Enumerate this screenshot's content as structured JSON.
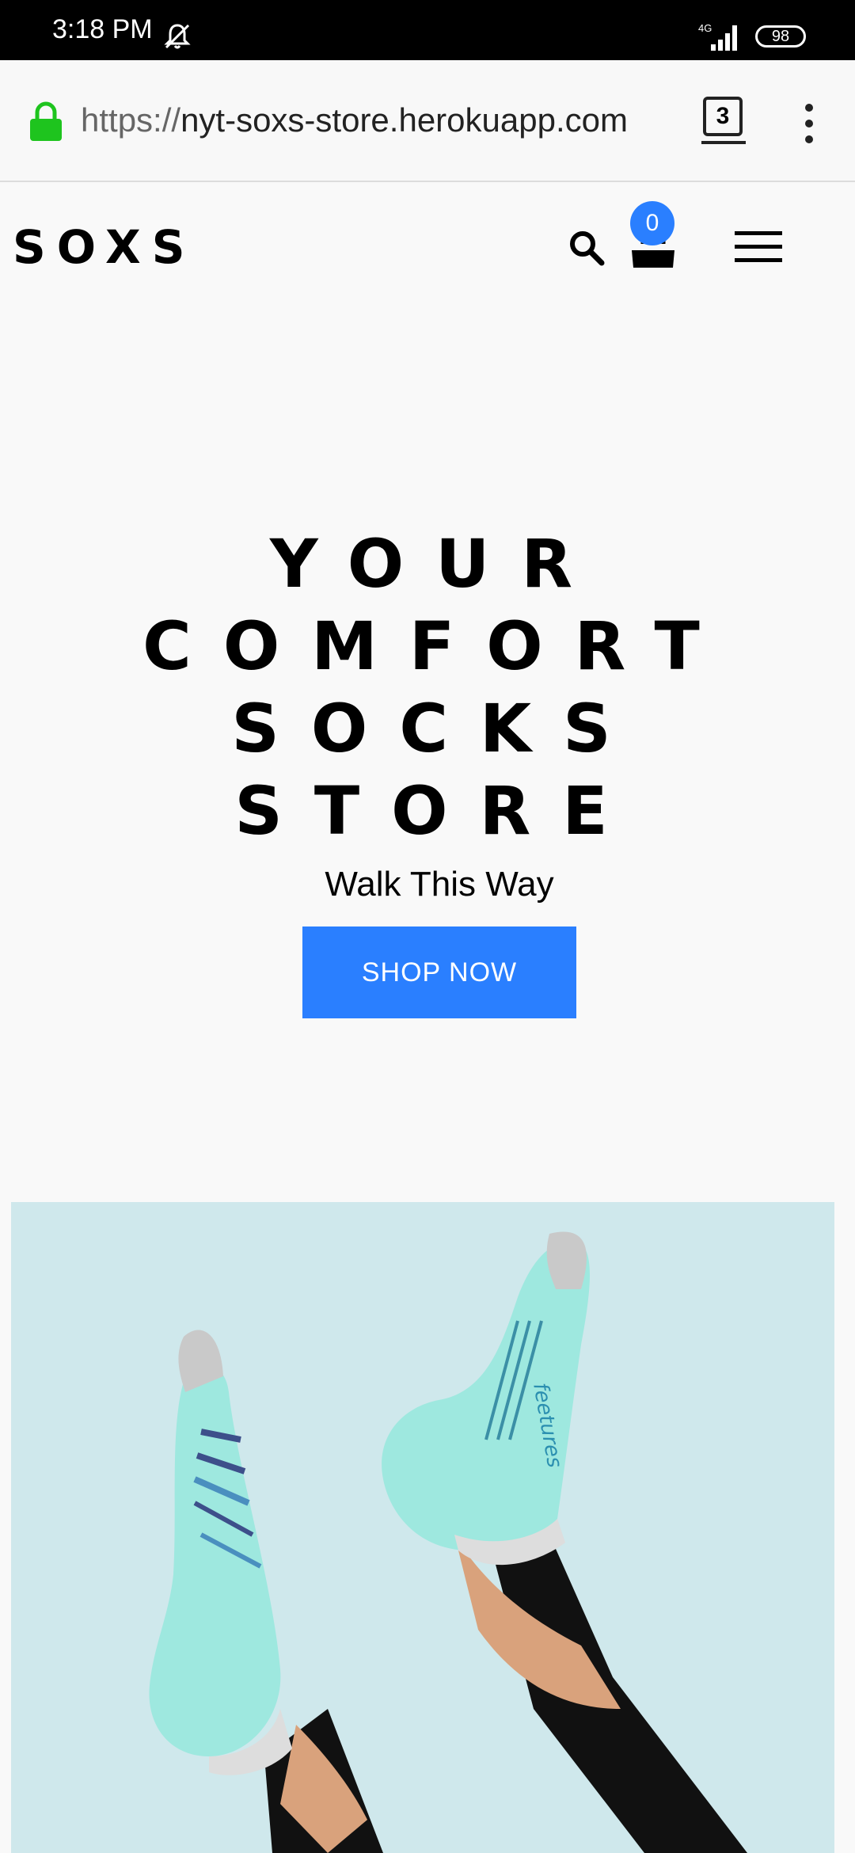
{
  "status_bar": {
    "time": "3:18 PM",
    "battery": "98",
    "network": "4G"
  },
  "browser": {
    "url_scheme": "https://",
    "url_host": "nyt-soxs-store.herokuapp.com",
    "tab_count": "3"
  },
  "header": {
    "logo": "SOXS",
    "cart_count": "0"
  },
  "hero": {
    "title_lines": [
      "YOUR",
      "COMFORT",
      "SOCKS",
      "STORE"
    ],
    "subtitle": "Walk This Way",
    "cta_label": "SHOP NOW",
    "image_text": "feetures"
  },
  "colors": {
    "accent": "#2a7fff",
    "hero_image_bg": "#cfe8ec",
    "sock": "#9ee8df"
  }
}
